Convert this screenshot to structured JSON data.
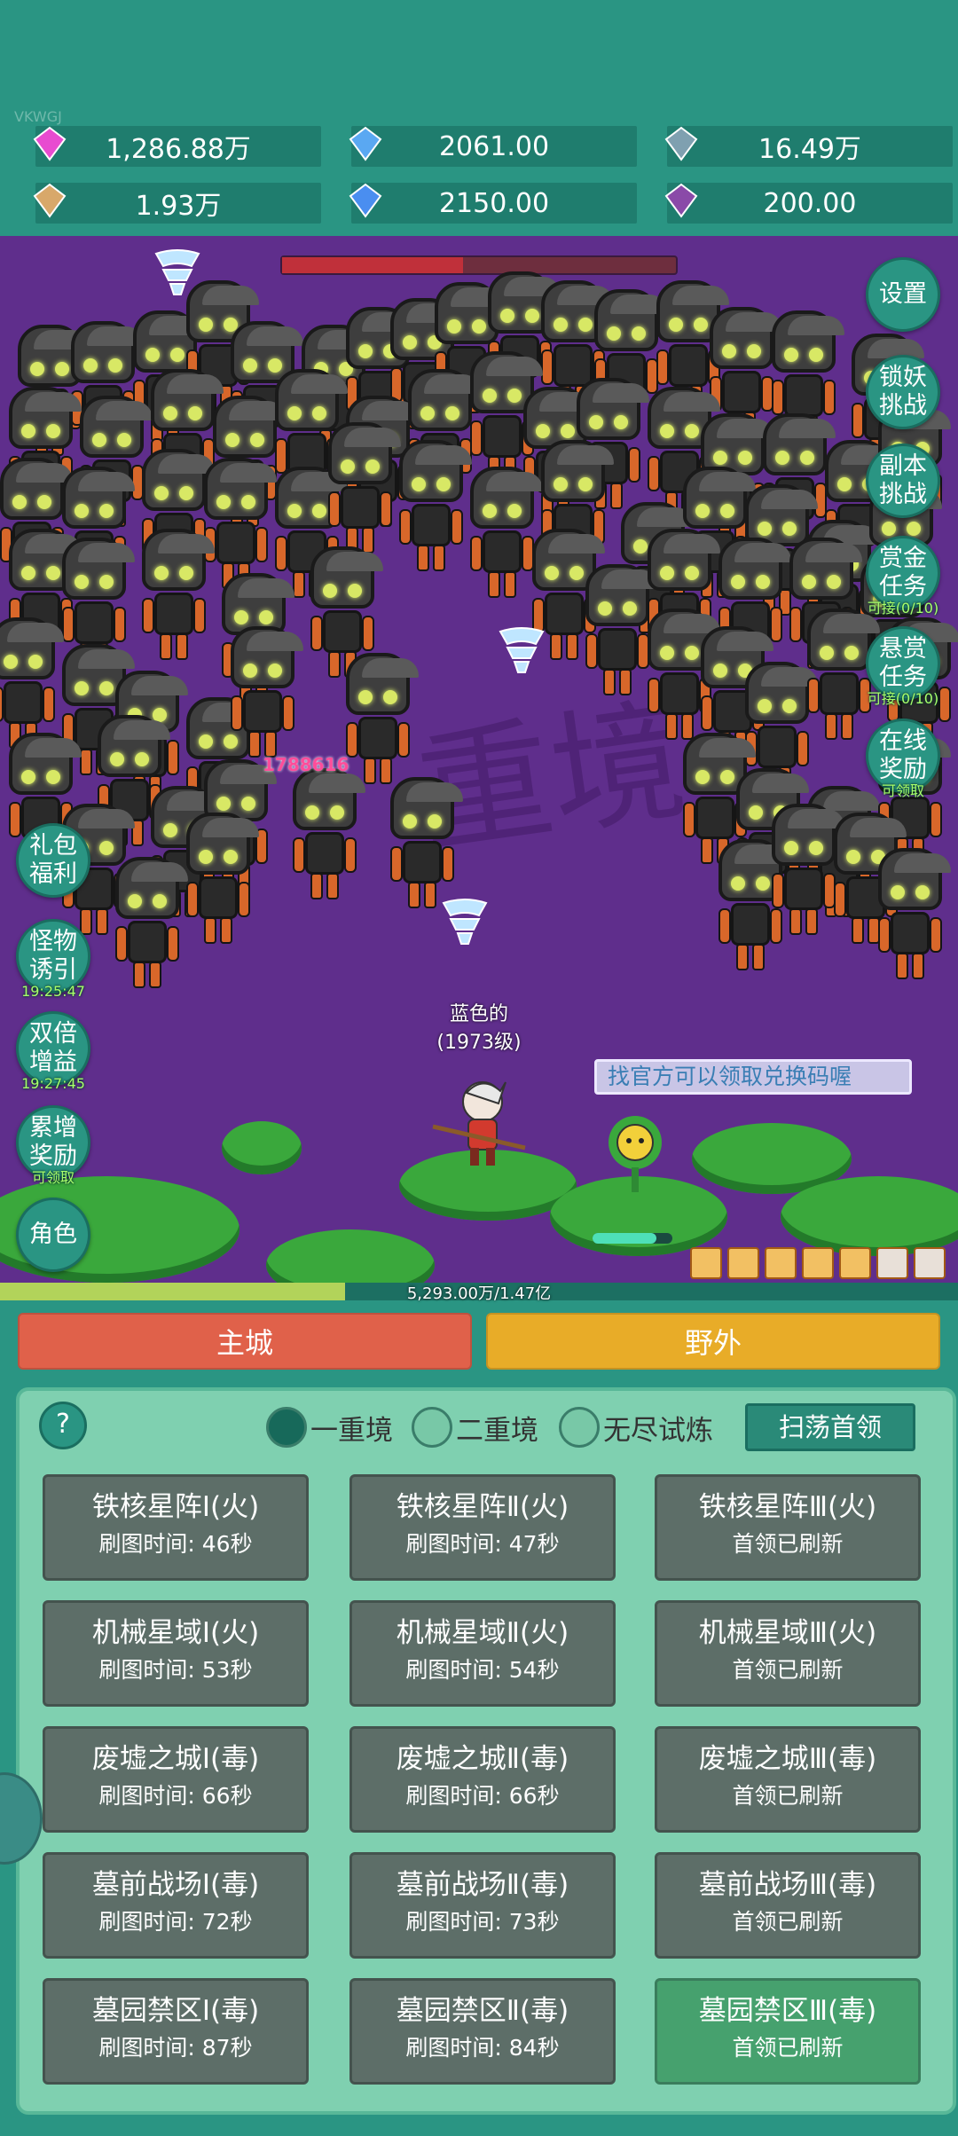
{
  "watermark": "VKWGJ",
  "resources": [
    {
      "icon": "diamond-icon",
      "value": "1,286.88万"
    },
    {
      "icon": "blue-orb-icon",
      "value": "2061.00"
    },
    {
      "icon": "globe-icon",
      "value": "16.49万"
    },
    {
      "icon": "scroll-icon",
      "value": "1.93万"
    },
    {
      "icon": "ice-crystal-icon",
      "value": "2150.00"
    },
    {
      "icon": "purple-pouch-icon",
      "value": "200.00"
    }
  ],
  "right_buttons": [
    {
      "label": "设置",
      "sub": ""
    },
    {
      "label": "锁妖\n挑战",
      "sub": ""
    },
    {
      "label": "副本\n挑战",
      "sub": ""
    },
    {
      "label": "赏金\n任务",
      "sub": "可接(0/10)"
    },
    {
      "label": "悬赏\n任务",
      "sub": "可接(0/10)"
    },
    {
      "label": "在线\n奖励",
      "sub": "可领取"
    }
  ],
  "left_buttons": [
    {
      "label": "礼包\n福利",
      "sub": ""
    },
    {
      "label": "怪物\n诱引",
      "sub": "19:25:47"
    },
    {
      "label": "双倍\n增益",
      "sub": "19:27:45"
    },
    {
      "label": "累增\n奖励",
      "sub": "可领取"
    },
    {
      "label": "角色",
      "sub": ""
    }
  ],
  "battle": {
    "seal_text": "重境",
    "damage_number": "1788616",
    "hero_name": "蓝色的",
    "hero_level": "(1973级)",
    "chat_message": "找官方可以领取兑换码喔"
  },
  "xp": {
    "text": "5,293.00万/1.47亿",
    "fraction": 0.36
  },
  "boss_hp_fraction": 0.46,
  "tabs": {
    "main_city": "主城",
    "wild": "野外"
  },
  "panel": {
    "help": "?",
    "modes": [
      {
        "label": "一重境",
        "selected": true
      },
      {
        "label": "二重境",
        "selected": false
      },
      {
        "label": "无尽试炼",
        "selected": false
      }
    ],
    "sweep_button": "扫荡首领",
    "stages": [
      {
        "title": "铁核星阵Ⅰ(火)",
        "sub": "刷图时间: 46秒"
      },
      {
        "title": "铁核星阵Ⅱ(火)",
        "sub": "刷图时间: 47秒"
      },
      {
        "title": "铁核星阵Ⅲ(火)",
        "sub": "首领已刷新"
      },
      {
        "title": "机械星域Ⅰ(火)",
        "sub": "刷图时间: 53秒"
      },
      {
        "title": "机械星域Ⅱ(火)",
        "sub": "刷图时间: 54秒"
      },
      {
        "title": "机械星域Ⅲ(火)",
        "sub": "首领已刷新"
      },
      {
        "title": "废墟之城Ⅰ(毒)",
        "sub": "刷图时间: 66秒"
      },
      {
        "title": "废墟之城Ⅱ(毒)",
        "sub": "刷图时间: 66秒"
      },
      {
        "title": "废墟之城Ⅲ(毒)",
        "sub": "首领已刷新"
      },
      {
        "title": "墓前战场Ⅰ(毒)",
        "sub": "刷图时间: 72秒"
      },
      {
        "title": "墓前战场Ⅱ(毒)",
        "sub": "刷图时间: 73秒"
      },
      {
        "title": "墓前战场Ⅲ(毒)",
        "sub": "首领已刷新"
      },
      {
        "title": "墓园禁区Ⅰ(毒)",
        "sub": "刷图时间: 87秒"
      },
      {
        "title": "墓园禁区Ⅱ(毒)",
        "sub": "刷图时间: 84秒"
      },
      {
        "title": "墓园禁区Ⅲ(毒)",
        "sub": "首领已刷新"
      }
    ]
  },
  "colors": {
    "accent": "#2a9583",
    "main_tab": "#e0614a",
    "wild_tab": "#e8ac28",
    "stage_bg": "#5d6e68",
    "stage_selected": "#46a16e"
  }
}
